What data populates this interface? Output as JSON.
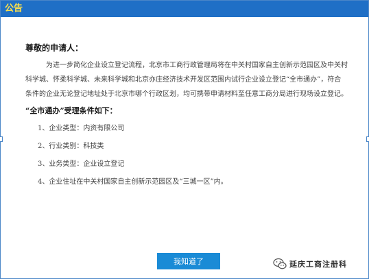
{
  "dialog": {
    "title": "公告"
  },
  "content": {
    "greeting": "尊敬的申请人：",
    "paragraph": "为进一步简化企业设立登记流程，北京市工商行政管理局将在中关村国家自主创新示范园区及中关村科学城、怀柔科学城、未来科学城和北京亦庄经济技术开发区范围内试行企业设立登记“全市通办”，符合条件的企业无论登记地址处于北京市哪个行政区划，均可携带申请材料至任意工商分局进行现场设立登记。",
    "conditions_title": "“全市通办”受理条件如下：",
    "conditions": [
      "1、企业类型：内资有限公司",
      "2、行业类别：科技类",
      "3、业务类型：企业设立登记",
      "4、企业住址在中关村国家自主创新示范园区及“三城一区”内。"
    ]
  },
  "button": {
    "ok_label": "我知道了"
  },
  "watermark": {
    "icon": "wechat-icon",
    "text": "延庆工商注册科"
  },
  "colors": {
    "titlebar": "#1f6fc6",
    "title_text": "#ffe14a",
    "button": "#1a8bd6"
  }
}
